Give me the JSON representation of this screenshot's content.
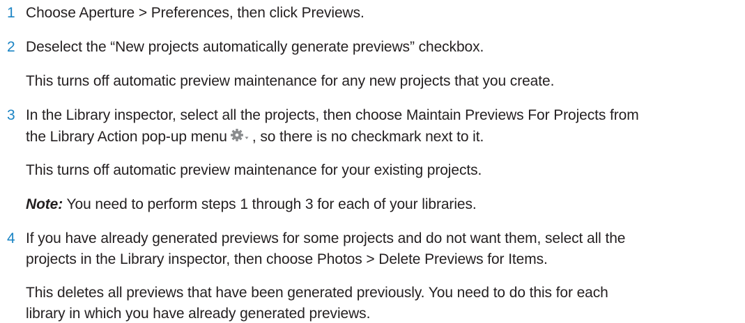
{
  "steps": [
    {
      "number": "1",
      "lines": [
        "Choose Aperture > Preferences, then click Previews."
      ]
    },
    {
      "number": "2",
      "lines": [
        "Deselect the “New projects automatically generate previews” checkbox."
      ],
      "followups": [
        "This turns off automatic preview maintenance for any new projects that you create."
      ]
    },
    {
      "number": "3",
      "lines": [
        "In the Library inspector, select all the projects, then choose Maintain Previews For Projects from",
        "the Library Action pop-up menu",
        ", so there is no checkmark next to it."
      ],
      "followups": [
        "This turns off automatic preview maintenance for your existing projects."
      ],
      "note_label": "Note:",
      "note_text": "You need to perform steps 1 through 3 for each of your libraries."
    },
    {
      "number": "4",
      "lines": [
        "If you have already generated previews for some projects and do not want them, select all the",
        "projects in the Library inspector, then choose Photos > Delete Previews for Items."
      ],
      "followups": [
        "This deletes all previews that have been generated previously. You need to do this for each",
        "library in which you have already generated previews."
      ]
    }
  ],
  "icons": {
    "library_action": "gear-popup-icon"
  },
  "colors": {
    "step_number": "#1b84c4",
    "text": "#231f20",
    "icon": "#8a8c8e"
  }
}
